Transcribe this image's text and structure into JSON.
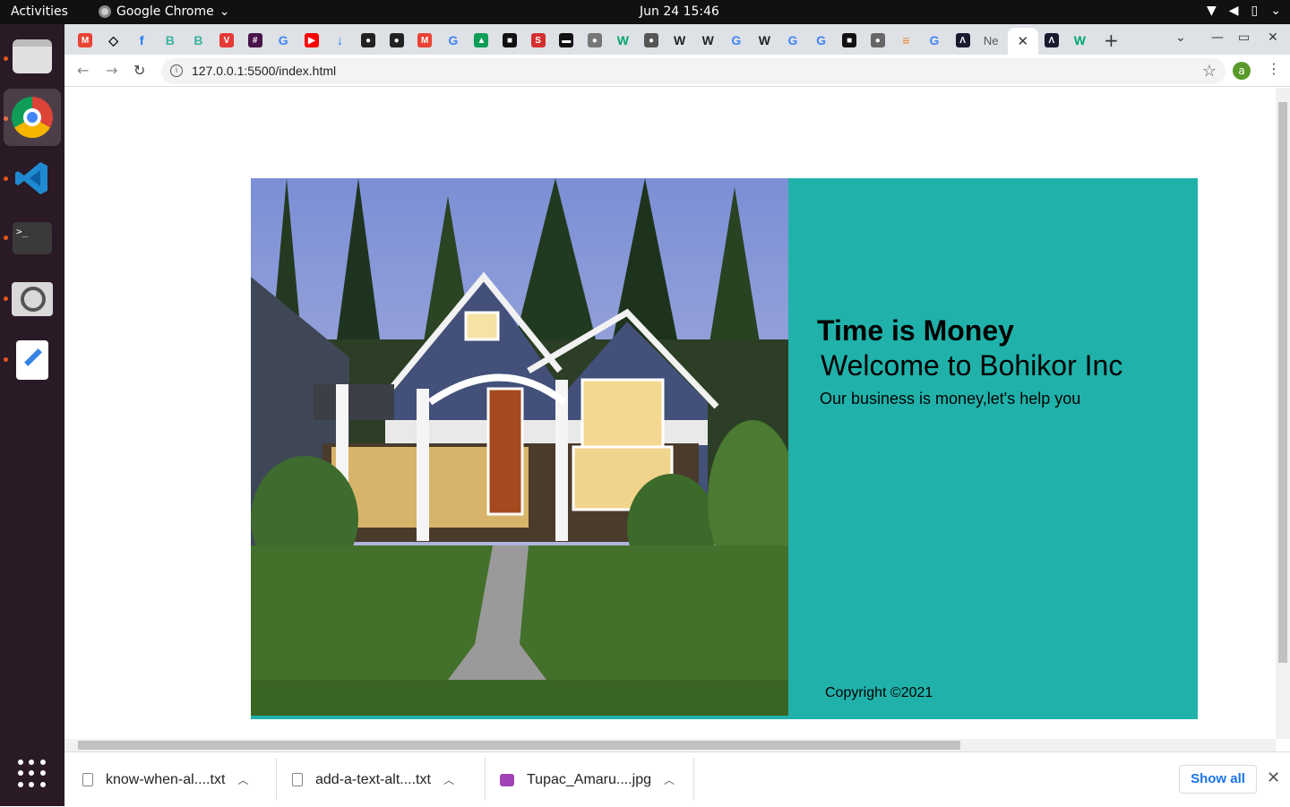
{
  "system": {
    "activities": "Activities",
    "app_name": "Google Chrome",
    "clock": "Jun 24  15:46"
  },
  "browser": {
    "url": "127.0.0.1:5500/index.html",
    "profile_initial": "a",
    "tabs": [
      {
        "icon": "gmail-icon",
        "glyph": "M",
        "color": "#ea4335"
      },
      {
        "icon": "codepen-icon",
        "glyph": "◇",
        "color": "#111111"
      },
      {
        "icon": "facebook-icon",
        "glyph": "f",
        "color": "#1877f2"
      },
      {
        "icon": "bookmark-doc-icon",
        "glyph": "B",
        "color": "#3bb4a0"
      },
      {
        "icon": "bookmark-doc-icon",
        "glyph": "B",
        "color": "#3bb4a0"
      },
      {
        "icon": "vivaldi-icon",
        "glyph": "V",
        "color": "#e53935"
      },
      {
        "icon": "slack-icon",
        "glyph": "#",
        "color": "#4a154b"
      },
      {
        "icon": "google-icon",
        "glyph": "G",
        "color": "#4285f4"
      },
      {
        "icon": "youtube-icon",
        "glyph": "▶",
        "color": "#ff0000"
      },
      {
        "icon": "download-icon",
        "glyph": "↓",
        "color": "#1a73e8"
      },
      {
        "icon": "github-icon",
        "glyph": "●",
        "color": "#222222"
      },
      {
        "icon": "github-icon",
        "glyph": "●",
        "color": "#222222"
      },
      {
        "icon": "gmail-icon",
        "glyph": "M",
        "color": "#ea4335"
      },
      {
        "icon": "google-icon",
        "glyph": "G",
        "color": "#4285f4"
      },
      {
        "icon": "drive-icon",
        "glyph": "▲",
        "color": "#0f9d58"
      },
      {
        "icon": "app-icon",
        "glyph": "■",
        "color": "#111111"
      },
      {
        "icon": "s-icon",
        "glyph": "S",
        "color": "#d32f2f"
      },
      {
        "icon": "terminal-icon",
        "glyph": "▬",
        "color": "#111111"
      },
      {
        "icon": "globe-icon",
        "glyph": "●",
        "color": "#777777"
      },
      {
        "icon": "w-icon",
        "glyph": "W",
        "color": "#00a86b"
      },
      {
        "icon": "globe-icon",
        "glyph": "●",
        "color": "#555555"
      },
      {
        "icon": "wikipedia-icon",
        "glyph": "W",
        "color": "#222222"
      },
      {
        "icon": "wikipedia-icon",
        "glyph": "W",
        "color": "#222222"
      },
      {
        "icon": "google-icon",
        "glyph": "G",
        "color": "#4285f4"
      },
      {
        "icon": "wikipedia-icon",
        "glyph": "W",
        "color": "#222222"
      },
      {
        "icon": "google-icon",
        "glyph": "G",
        "color": "#4285f4"
      },
      {
        "icon": "google-icon",
        "glyph": "G",
        "color": "#4285f4"
      },
      {
        "icon": "app-icon",
        "glyph": "■",
        "color": "#111111"
      },
      {
        "icon": "globe-icon",
        "glyph": "●",
        "color": "#666666"
      },
      {
        "icon": "stackoverflow-icon",
        "glyph": "≡",
        "color": "#f48024"
      },
      {
        "icon": "google-icon",
        "glyph": "G",
        "color": "#4285f4"
      },
      {
        "icon": "app-icon",
        "glyph": "Λ",
        "color": "#1a1a2e"
      },
      {
        "icon": "ne-tab",
        "glyph": "Ne",
        "color": "#555555"
      }
    ],
    "tabs_after_active": [
      {
        "icon": "app-icon",
        "glyph": "Λ",
        "color": "#1a1a2e"
      },
      {
        "icon": "w-icon",
        "glyph": "W",
        "color": "#00a86b"
      }
    ]
  },
  "page": {
    "hero_title": "Time is Money",
    "hero_subtitle": "Welcome to Bohikor Inc",
    "hero_tagline": "Our business is money,let's help you",
    "copyright": "Copyright ©2021",
    "accent_color": "#20b2aa"
  },
  "downloads": {
    "items": [
      {
        "name": "know-when-al....txt",
        "type": "text"
      },
      {
        "name": "add-a-text-alt....txt",
        "type": "text"
      },
      {
        "name": "Tupac_Amaru....jpg",
        "type": "image"
      }
    ],
    "show_all": "Show all"
  }
}
